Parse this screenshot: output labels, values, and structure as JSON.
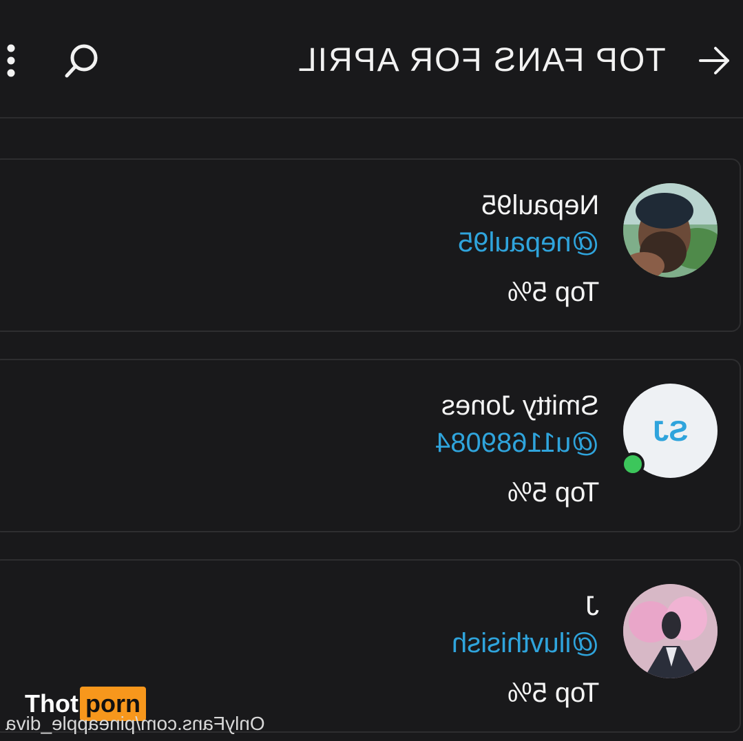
{
  "header": {
    "title": "TOP FANS FOR APRIL"
  },
  "icons": {
    "back": "arrow-icon",
    "search": "search-icon",
    "more": "more-vertical-icon"
  },
  "fans": [
    {
      "name": "Nepaul95",
      "handle": "@nepaul95",
      "rank": "Top 5%",
      "avatar": "photo"
    },
    {
      "name": "Smitty Jones",
      "handle": "@u11689084",
      "rank": "Top 5%",
      "avatar_initials": "SJ",
      "online": true
    },
    {
      "name": "J",
      "handle": "@iluvthisish",
      "rank": "Top 5%",
      "avatar": "photo"
    }
  ],
  "watermark": {
    "brand_part1": "Thot",
    "brand_part2": "porn",
    "url": "OnlyFans.com/pineapple_diva"
  },
  "colors": {
    "background": "#19191b",
    "handle": "#2fa4dc",
    "online": "#3cc65b",
    "brand_accent": "#f7971c"
  }
}
